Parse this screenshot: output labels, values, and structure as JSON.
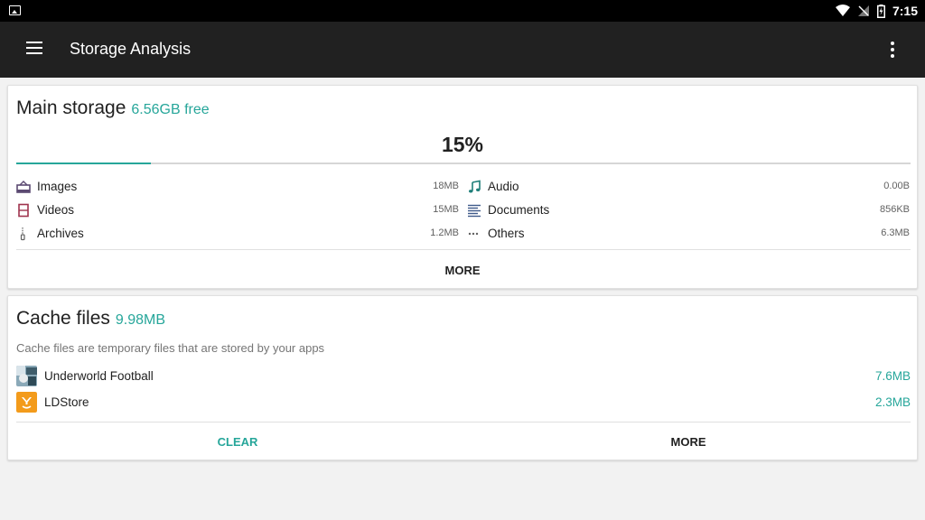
{
  "status_bar": {
    "time": "7:15"
  },
  "app_bar": {
    "title": "Storage Analysis"
  },
  "main_storage": {
    "title": "Main storage",
    "free": "6.56GB free",
    "percent_label": "15%",
    "used_fraction": 0.15,
    "accent_color": "#26a69a",
    "categories": [
      {
        "name": "Images",
        "size": "18MB",
        "icon": "image-icon"
      },
      {
        "name": "Audio",
        "size": "0.00B",
        "icon": "music-note-icon"
      },
      {
        "name": "Videos",
        "size": "15MB",
        "icon": "film-icon"
      },
      {
        "name": "Documents",
        "size": "856KB",
        "icon": "document-lines-icon"
      },
      {
        "name": "Archives",
        "size": "1.2MB",
        "icon": "archive-zip-icon"
      },
      {
        "name": "Others",
        "size": "6.3MB",
        "icon": "more-horizontal-icon"
      }
    ],
    "more_label": "MORE"
  },
  "cache_files": {
    "title": "Cache files",
    "size": "9.98MB",
    "description": "Cache files are temporary files that are stored by your apps",
    "apps": [
      {
        "name": "Underworld Football",
        "size": "7.6MB",
        "icon": "underworld-football-app-icon"
      },
      {
        "name": "LDStore",
        "size": "2.3MB",
        "icon": "ldstore-app-icon"
      }
    ],
    "clear_label": "CLEAR",
    "more_label": "MORE"
  }
}
